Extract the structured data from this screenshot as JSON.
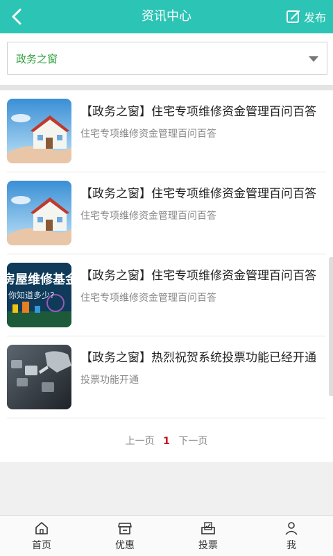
{
  "header": {
    "title": "资讯中心",
    "publish_label": "发布"
  },
  "filter": {
    "selected": "政务之窗"
  },
  "articles": [
    {
      "title": "【政务之窗】住宅专项维修资金管理百问百答",
      "subtitle": "住宅专项维修资金管理百问百答",
      "thumb": "house-in-hands"
    },
    {
      "title": "【政务之窗】住宅专项维修资金管理百问百答",
      "subtitle": "住宅专项维修资金管理百问百答",
      "thumb": "house-in-hands"
    },
    {
      "title": "【政务之窗】住宅专项维修资金管理百问百答",
      "subtitle": "住宅专项维修资金管理百问百答",
      "thumb": "house-repair-fund-poster",
      "thumb_text": "房屋维修基金",
      "thumb_subtext": "你知道多少?"
    },
    {
      "title": "【政务之窗】热烈祝贺系统投票功能已经开通",
      "subtitle": "投票功能开通",
      "thumb": "touchscreen-hand"
    }
  ],
  "pager": {
    "prev": "上一页",
    "current": "1",
    "next": "下一页"
  },
  "tabs": [
    {
      "label": "首页",
      "icon": "home-icon"
    },
    {
      "label": "优惠",
      "icon": "store-icon"
    },
    {
      "label": "投票",
      "icon": "ballot-box-icon"
    },
    {
      "label": "我",
      "icon": "user-icon"
    }
  ],
  "colors": {
    "header_bg": "#2cc4b5",
    "filter_text": "#2e9e3d",
    "pager_current": "#d0021b"
  }
}
